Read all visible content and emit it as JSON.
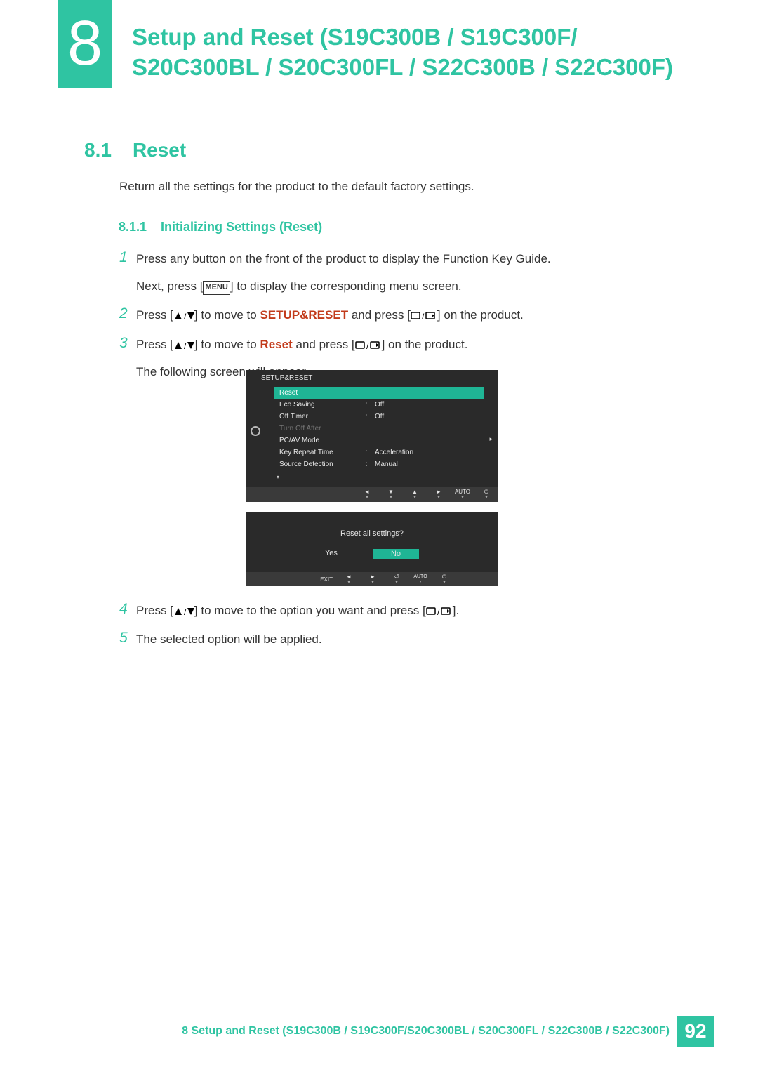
{
  "chapter": {
    "number": "8",
    "title": "Setup and Reset (S19C300B / S19C300F/ S20C300BL / S20C300FL / S22C300B / S22C300F)"
  },
  "section81": {
    "num": "8.1",
    "title": "Reset"
  },
  "intro": "Return all the settings for the product to the default factory settings.",
  "section811": {
    "num": "8.1.1",
    "title": "Initializing Settings (Reset)"
  },
  "steps": {
    "s1a": "Press any button on the front of the product to display the Function Key Guide.",
    "s1b_pre": "Next, press [",
    "menuLabel": "MENU",
    "s1b_post": "] to display the corresponding menu screen.",
    "s2_pre": "Press [",
    "s2_mid1": "] to move to ",
    "setupReset": "SETUP&RESET",
    "s2_mid2": " and press [",
    "s2_post": "] on the product.",
    "s3_pre": "Press [",
    "s3_mid1": "] to move to ",
    "reset": "Reset",
    "s3_mid2": " and press [",
    "s3_post": "] on the product.",
    "s3_follow": "The following screen will appear.",
    "s4_pre": "Press [",
    "s4_mid": "] to move to the option you want and press [",
    "s4_post": "].",
    "s5": "The selected option will be applied."
  },
  "osd1": {
    "title": "SETUP&RESET",
    "rows": [
      {
        "label": "Reset",
        "value": ""
      },
      {
        "label": "Eco Saving",
        "value": "Off"
      },
      {
        "label": "Off Timer",
        "value": "Off"
      },
      {
        "label": "Turn Off After",
        "value": ""
      },
      {
        "label": "PC/AV Mode",
        "value": ""
      },
      {
        "label": "Key Repeat Time",
        "value": "Acceleration"
      },
      {
        "label": "Source Detection",
        "value": "Manual"
      }
    ],
    "autoLabel": "AUTO"
  },
  "osd2": {
    "question": "Reset all settings?",
    "yes": "Yes",
    "no": "No",
    "exit": "EXIT",
    "autoLabel": "AUTO"
  },
  "footer": {
    "text": "8 Setup and Reset (S19C300B / S19C300F/S20C300BL / S20C300FL / S22C300B / S22C300F)",
    "page": "92"
  },
  "stepNums": {
    "n1": "1",
    "n2": "2",
    "n3": "3",
    "n4": "4",
    "n5": "5"
  }
}
